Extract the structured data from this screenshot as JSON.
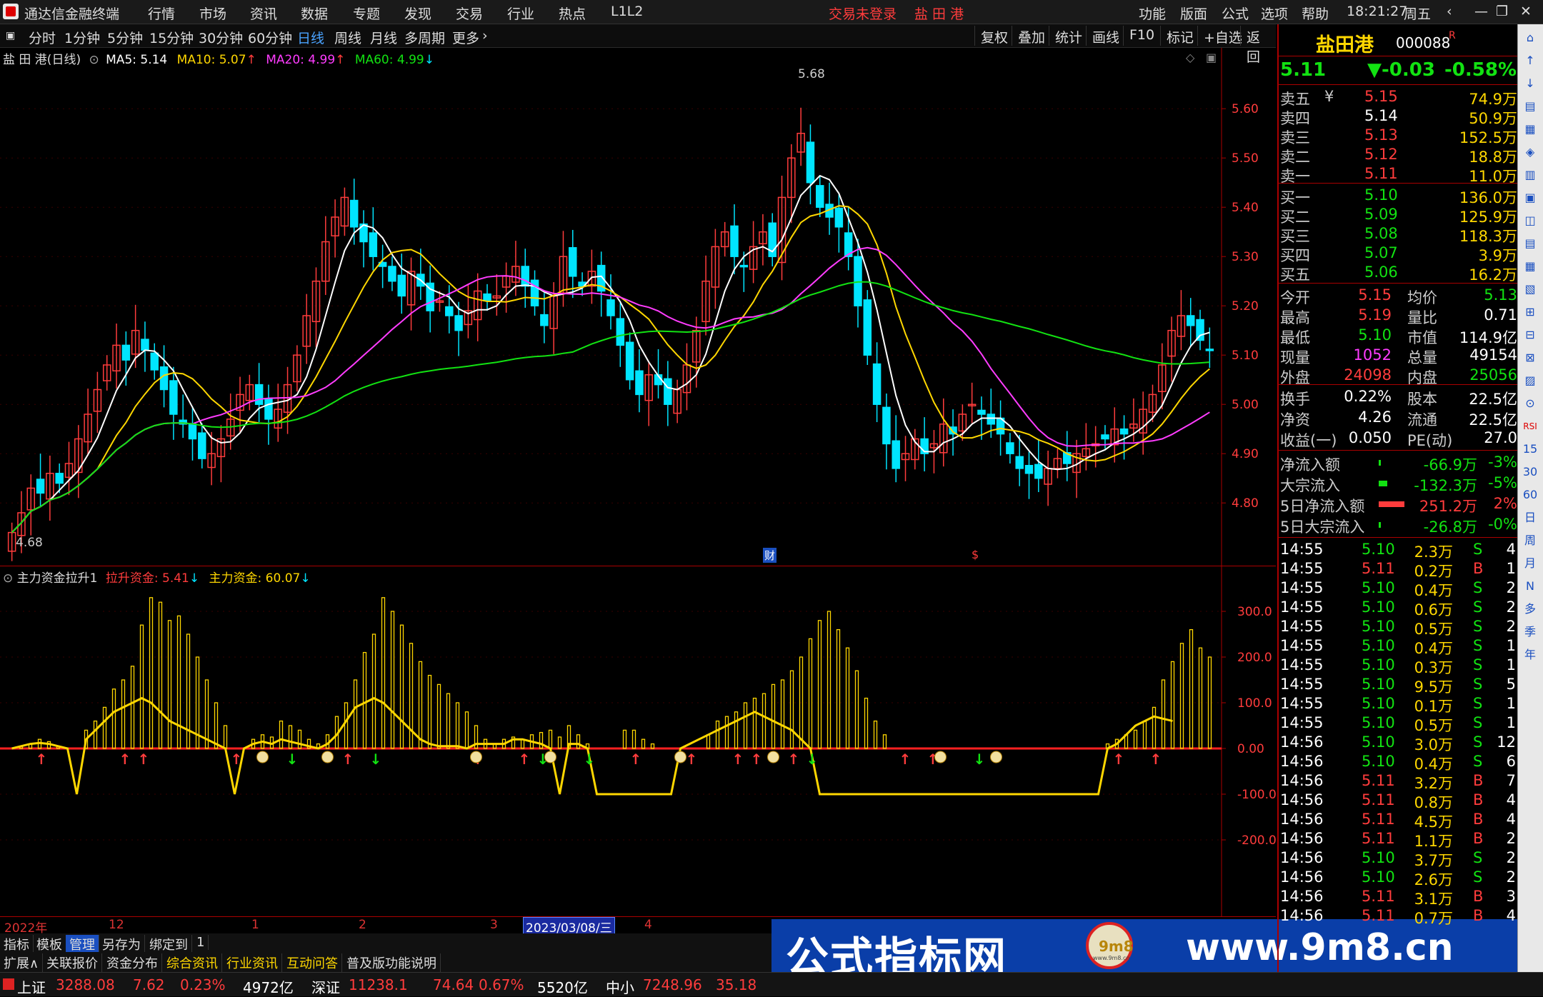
{
  "titlebar": {
    "app_name": "通达信金融终端",
    "menu": [
      "行情",
      "市场",
      "资讯",
      "数据",
      "专题",
      "发现",
      "交易",
      "行业",
      "热点",
      "L1L2"
    ],
    "login_status": "交易未登录",
    "stock_title": "盐 田 港",
    "right_menu": [
      "功能",
      "版面",
      "公式",
      "选项",
      "帮助"
    ],
    "time": "18:21:27",
    "weekday": "周五"
  },
  "toolbar": {
    "periods": [
      "分时",
      "1分钟",
      "5分钟",
      "15分钟",
      "30分钟",
      "60分钟",
      "日线",
      "周线",
      "月线",
      "多周期",
      "更多"
    ],
    "selected": "日线",
    "more_icon": "chevron-right-icon",
    "buttons": [
      "复权",
      "叠加",
      "统计",
      "画线",
      "F10",
      "标记",
      "+自选",
      "返回"
    ]
  },
  "main_legend": {
    "title": "盐 田 港(日线)",
    "ma5": "MA5: 5.14",
    "ma10": "MA10: 5.07",
    "ma20": "MA20: 4.99",
    "ma60": "MA60: 4.99",
    "high_label": "5.68",
    "low_label": "4.68",
    "event_cai": "财",
    "event_dollar": "$"
  },
  "sub_legend": {
    "title": "主力资金拉升1",
    "lift": "拉升资金: 5.41",
    "main": "主力资金: 60.07"
  },
  "date_bar": {
    "labels": [
      "2022年",
      "12",
      "1",
      "2",
      "3",
      "2023/03/08/三",
      "4"
    ]
  },
  "colors": {
    "up": "#ff3c3c",
    "down": "#00e5ff",
    "ma5": "#ffffff",
    "ma10": "#ffd700",
    "ma20": "#ff3cff",
    "ma60": "#12e212",
    "bars": "#ffd700"
  },
  "chart_data": [
    {
      "type": "candlestick",
      "title": "盐 田 港(日线)",
      "ylim": [
        4.68,
        5.68
      ],
      "y_ticks": [
        "5.60",
        "5.50",
        "5.40",
        "5.30",
        "5.20",
        "5.10",
        "5.00",
        "4.90",
        "4.80"
      ],
      "close_approx": [
        4.74,
        4.78,
        4.83,
        4.82,
        4.86,
        4.84,
        4.88,
        4.93,
        4.98,
        5.03,
        5.08,
        5.12,
        5.09,
        5.15,
        5.11,
        5.07,
        5.03,
        4.98,
        4.96,
        4.93,
        4.89,
        4.9,
        4.93,
        4.97,
        5.02,
        5.04,
        5.0,
        4.97,
        4.99,
        5.04,
        5.1,
        5.18,
        5.25,
        5.33,
        5.38,
        5.42,
        5.36,
        5.33,
        5.3,
        5.28,
        5.25,
        5.22,
        5.27,
        5.24,
        5.19,
        5.21,
        5.18,
        5.15,
        5.19,
        5.23,
        5.21,
        5.22,
        5.26,
        5.28,
        5.24,
        5.2,
        5.16,
        5.22,
        5.3,
        5.26,
        5.24,
        5.27,
        5.23,
        5.18,
        5.12,
        5.05,
        5.02,
        5.06,
        5.04,
        5.0,
        5.03,
        5.08,
        5.15,
        5.25,
        5.32,
        5.35,
        5.3,
        5.28,
        5.32,
        5.35,
        5.3,
        5.42,
        5.5,
        5.55,
        5.45,
        5.4,
        5.38,
        5.36,
        5.3,
        5.2,
        5.1,
        5.0,
        4.92,
        4.87,
        4.9,
        4.93,
        4.9,
        4.92,
        4.96,
        4.94,
        4.98,
        5.0,
        4.98,
        4.96,
        4.94,
        4.9,
        4.87,
        4.86,
        4.85,
        4.87,
        4.89,
        4.88,
        4.9,
        4.91,
        4.92,
        4.93,
        4.95,
        4.94,
        4.96,
        4.99,
        5.02,
        5.08,
        5.15,
        5.18,
        5.16,
        5.13,
        5.11
      ]
    },
    {
      "type": "bar",
      "title": "主力资金拉升1",
      "ylim": [
        -200,
        300
      ],
      "y_ticks": [
        "300.0",
        "200.0",
        "100.0",
        "0.00",
        "-100.0",
        "-200.0"
      ],
      "values": [
        0,
        5,
        10,
        20,
        15,
        5,
        0,
        0,
        40,
        60,
        90,
        130,
        150,
        180,
        270,
        330,
        320,
        280,
        290,
        250,
        200,
        150,
        100,
        50,
        0,
        0,
        20,
        30,
        25,
        60,
        50,
        40,
        20,
        10,
        30,
        70,
        100,
        150,
        210,
        250,
        330,
        300,
        270,
        230,
        190,
        160,
        140,
        120,
        100,
        80,
        50,
        20,
        10,
        20,
        25,
        20,
        30,
        35,
        40,
        25,
        50,
        30,
        10,
        0,
        0,
        0,
        40,
        40,
        20,
        10,
        0,
        0,
        0,
        0,
        0,
        30,
        60,
        70,
        80,
        100,
        110,
        120,
        140,
        150,
        170,
        200,
        240,
        280,
        300,
        260,
        220,
        170,
        110,
        60,
        30,
        0,
        0,
        0,
        0,
        0,
        0,
        0,
        0,
        0,
        0,
        0,
        0,
        0,
        0,
        0,
        0,
        0,
        0,
        0,
        0,
        0,
        0,
        0,
        10,
        20,
        30,
        40,
        60,
        90,
        150,
        190,
        230,
        260,
        220,
        200
      ],
      "line": [
        0,
        5,
        10,
        12,
        10,
        5,
        0,
        -100,
        20,
        40,
        60,
        80,
        90,
        100,
        110,
        100,
        80,
        60,
        50,
        40,
        30,
        20,
        10,
        0,
        -100,
        0,
        10,
        15,
        10,
        20,
        15,
        10,
        5,
        0,
        10,
        30,
        60,
        90,
        100,
        110,
        100,
        80,
        60,
        40,
        20,
        10,
        5,
        5,
        5,
        0,
        10,
        10,
        10,
        10,
        20,
        20,
        15,
        10,
        0,
        -100,
        10,
        10,
        0,
        -100,
        -100,
        -100,
        -100,
        -100,
        -100,
        -100,
        -100,
        -100,
        0,
        10,
        20,
        30,
        40,
        50,
        60,
        70,
        80,
        70,
        60,
        50,
        40,
        20,
        0,
        -100,
        -100,
        -100,
        -100,
        -100,
        -100,
        -100,
        -100,
        -100,
        -100,
        -100,
        -100,
        -100,
        -100,
        -100,
        -100,
        -100,
        -100,
        -100,
        -100,
        -100,
        -100,
        -100,
        -100,
        -100,
        -100,
        -100,
        -100,
        -100,
        -100,
        -100,
        0,
        10,
        30,
        50,
        60,
        70,
        65,
        60
      ]
    }
  ],
  "quote": {
    "name": "盐田港",
    "code": "000088",
    "code_sup": "R",
    "price": "5.11",
    "change": "▼-0.03",
    "change_pct": "-0.58%",
    "asks": [
      {
        "label": "卖五",
        "price": "5.15",
        "vol": "74.9万"
      },
      {
        "label": "卖四",
        "price": "5.14",
        "vol": "50.9万"
      },
      {
        "label": "卖三",
        "price": "5.13",
        "vol": "152.5万"
      },
      {
        "label": "卖二",
        "price": "5.12",
        "vol": "18.8万"
      },
      {
        "label": "卖一",
        "price": "5.11",
        "vol": "11.0万"
      }
    ],
    "ask_currency": "¥",
    "bids": [
      {
        "label": "买一",
        "price": "5.10",
        "vol": "136.0万"
      },
      {
        "label": "买二",
        "price": "5.09",
        "vol": "125.9万"
      },
      {
        "label": "买三",
        "price": "5.08",
        "vol": "118.3万"
      },
      {
        "label": "买四",
        "price": "5.07",
        "vol": "3.9万"
      },
      {
        "label": "买五",
        "price": "5.06",
        "vol": "16.2万"
      }
    ],
    "stats1": [
      {
        "l": "今开",
        "v": "5.15",
        "l2": "均价",
        "v2": "5.13"
      },
      {
        "l": "最高",
        "v": "5.19",
        "l2": "量比",
        "v2": "0.71"
      },
      {
        "l": "最低",
        "v": "5.10",
        "l2": "市值",
        "v2": "114.9亿"
      },
      {
        "l": "现量",
        "v": "1052",
        "l2": "总量",
        "v2": "49154"
      },
      {
        "l": "外盘",
        "v": "24098",
        "l2": "内盘",
        "v2": "25056"
      }
    ],
    "stats2": [
      {
        "l": "换手",
        "v": "0.22%",
        "l2": "股本",
        "v2": "22.5亿"
      },
      {
        "l": "净资",
        "v": "4.26",
        "l2": "流通",
        "v2": "22.5亿"
      },
      {
        "l": "收益(一)",
        "v": "0.050",
        "l2": "PE(动)",
        "v2": "27.0"
      }
    ],
    "flows": [
      {
        "l": "净流入额",
        "v": "-66.9万",
        "p": "-3%",
        "bar": 0.05,
        "c": "green"
      },
      {
        "l": "大宗流入",
        "v": "-132.3万",
        "p": "-5%",
        "bar": 0.2,
        "c": "green"
      },
      {
        "l": "5日净流入额",
        "v": "251.2万",
        "p": "2%",
        "bar": 0.6,
        "c": "red"
      },
      {
        "l": "5日大宗流入",
        "v": "-26.8万",
        "p": "-0%",
        "bar": 0.02,
        "c": "green"
      }
    ],
    "ticks": [
      [
        "14:55",
        "5.10",
        "2.3万",
        "S",
        "4"
      ],
      [
        "14:55",
        "5.11",
        "0.2万",
        "B",
        "1"
      ],
      [
        "14:55",
        "5.10",
        "0.4万",
        "S",
        "2"
      ],
      [
        "14:55",
        "5.10",
        "0.6万",
        "S",
        "2"
      ],
      [
        "14:55",
        "5.10",
        "0.5万",
        "S",
        "2"
      ],
      [
        "14:55",
        "5.10",
        "0.4万",
        "S",
        "1"
      ],
      [
        "14:55",
        "5.10",
        "0.3万",
        "S",
        "1"
      ],
      [
        "14:55",
        "5.10",
        "9.5万",
        "S",
        "5"
      ],
      [
        "14:55",
        "5.10",
        "0.1万",
        "S",
        "1"
      ],
      [
        "14:55",
        "5.10",
        "0.5万",
        "S",
        "1"
      ],
      [
        "14:56",
        "5.10",
        "3.0万",
        "S",
        "12"
      ],
      [
        "14:56",
        "5.10",
        "0.4万",
        "S",
        "6"
      ],
      [
        "14:56",
        "5.11",
        "3.2万",
        "B",
        "7"
      ],
      [
        "14:56",
        "5.11",
        "0.8万",
        "B",
        "4"
      ],
      [
        "14:56",
        "5.11",
        "4.5万",
        "B",
        "4"
      ],
      [
        "14:56",
        "5.11",
        "1.1万",
        "B",
        "2"
      ],
      [
        "14:56",
        "5.10",
        "3.7万",
        "S",
        "2"
      ],
      [
        "14:56",
        "5.10",
        "2.6万",
        "S",
        "2"
      ],
      [
        "14:56",
        "5.11",
        "3.1万",
        "B",
        "3"
      ],
      [
        "14:56",
        "5.11",
        "0.7万",
        "B",
        "4"
      ]
    ]
  },
  "right_icons": [
    "RSI",
    "15",
    "30",
    "60",
    "日",
    "周",
    "月",
    "N",
    "多",
    "季",
    "年"
  ],
  "tabs1": [
    "指标",
    "模板",
    "管理",
    "另存为",
    "绑定到",
    "1"
  ],
  "tabs2": [
    "扩展∧",
    "关联报价",
    "资金分布",
    "综合资讯",
    "行业资讯",
    "互动问答",
    "普及版功能说明"
  ],
  "status": {
    "sh_label": "上证",
    "sh_val": "3288.08",
    "sh_chg": "7.62",
    "sh_pct": "0.23%",
    "sh_amt": "4972亿",
    "sz_label": "深证",
    "sz_val": "11238.1",
    "sz_chg": "74.64",
    "sz_pct": "0.67%",
    "sz_amt": "5520亿",
    "zx_label": "中小",
    "zx_val": "7248.96",
    "zx_chg": "35.18"
  },
  "banner": {
    "text": "公式指标网",
    "url": "www.9m8.cn",
    "logo_text": "9m8",
    "logo_url": "www.9m8.cn"
  }
}
